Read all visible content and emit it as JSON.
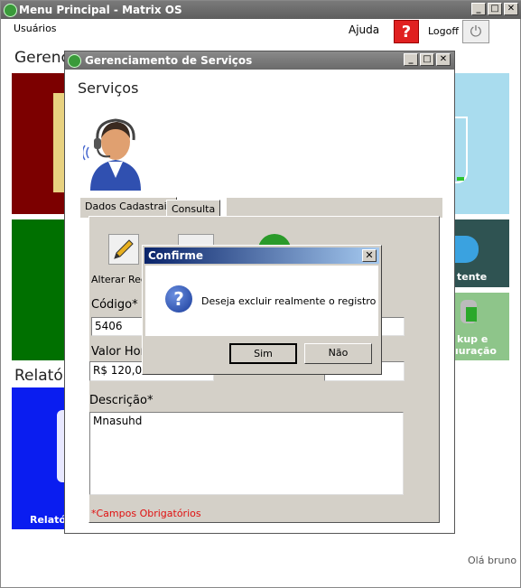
{
  "window": {
    "title": "Menu Principal - Matrix OS"
  },
  "menu": {
    "usuarios": "Usuários"
  },
  "header": {
    "ajuda": "Ajuda",
    "help_icon": "?",
    "logoff": "Logoff"
  },
  "sections": {
    "gerencia": "Gerencia",
    "relatorios": "Relatório"
  },
  "tiles": {
    "cliente_label": "tente",
    "backup_label": "kup e",
    "backup_label2": "ıuração",
    "relatorio_label": "Relató"
  },
  "footer": {
    "greeting": "Olá bruno"
  },
  "colors": {
    "darkred": "#7c0000",
    "green": "#007000",
    "blue": "#0a1df0",
    "lightblue": "#a9dcee",
    "teal": "#2f5352",
    "lightgreen": "#8ec58a"
  },
  "subwindow": {
    "title": "Gerenciamento de Serviços",
    "heading": "Serviços",
    "tabs": [
      "Dados Cadastrais",
      "Consulta"
    ],
    "alterar_label": "Alterar Reg",
    "codigo_label": "Código*",
    "codigo_value": "5406",
    "valor_label": "Valor Hor",
    "valor_value": "R$ 120,00",
    "descricao_label": "Descrição*",
    "descricao_value": "Mnasuhd",
    "required_note": "*Campos Obrigatórios"
  },
  "dialog": {
    "title": "Confirme",
    "message": "Deseja excluir realmente o registro",
    "icon": "?",
    "yes": "Sim",
    "no": "Não"
  }
}
